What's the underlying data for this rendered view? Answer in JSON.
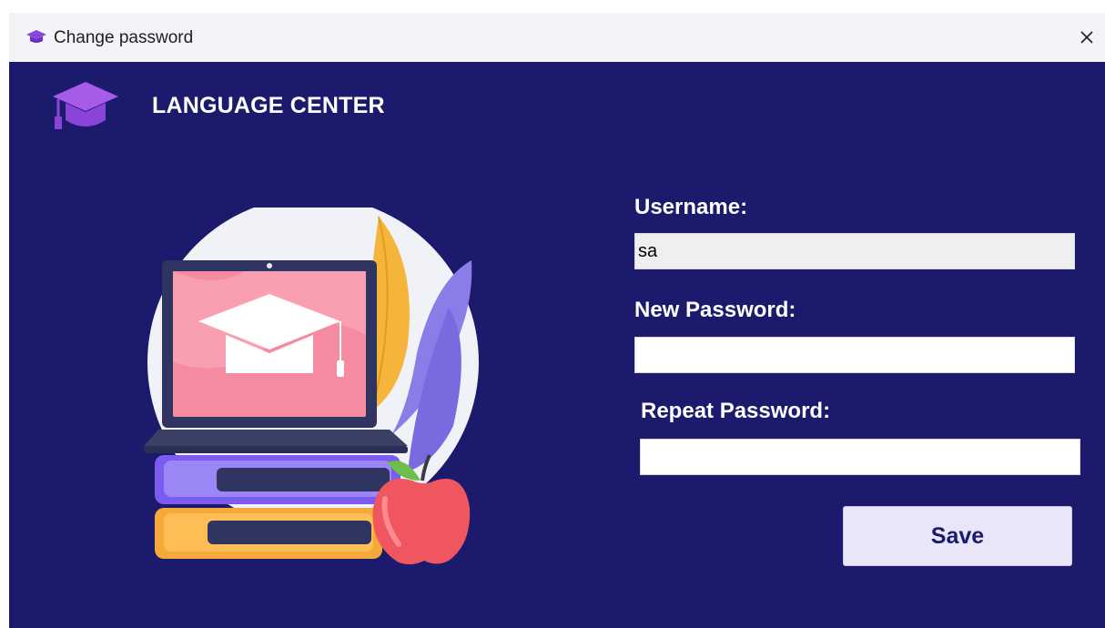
{
  "window": {
    "title": "Change password",
    "close_symbol": "✕"
  },
  "brand": {
    "name": "LANGUAGE CENTER",
    "logo_icon": "graduation-cap-icon"
  },
  "form": {
    "username_label": "Username:",
    "username_value": "sa",
    "new_password_label": "New Password:",
    "new_password_value": "",
    "repeat_password_label": "Repeat Password:",
    "repeat_password_value": "",
    "save_label": "Save"
  },
  "colors": {
    "background": "#1b1a6c",
    "accent_purple": "#8a45d8",
    "button_bg": "#e8e6f8"
  }
}
